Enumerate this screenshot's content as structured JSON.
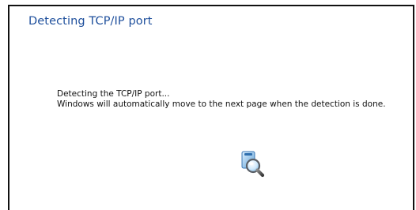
{
  "window": {
    "title": "Detecting TCP/IP port"
  },
  "content": {
    "status_line": "Detecting the TCP/IP port...",
    "info_line": "Windows will automatically move to the next page when the detection is done."
  },
  "icons": {
    "progress": "search-icon"
  },
  "colors": {
    "title": "#1e4f9c",
    "text": "#111111",
    "background": "#ffffff",
    "frame": "#111111"
  }
}
